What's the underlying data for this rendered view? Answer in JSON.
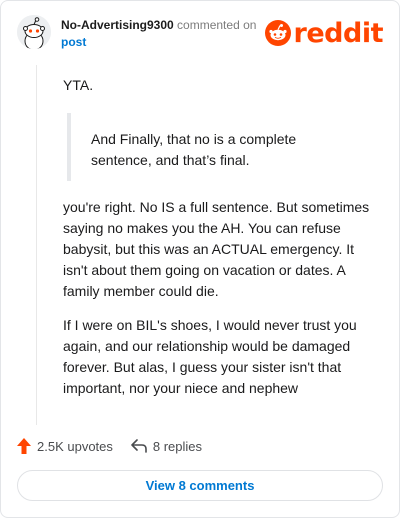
{
  "header": {
    "username": "No-Advertising9300",
    "commented_text": "commented on",
    "post_link": "post",
    "logo_text": "reddit"
  },
  "comment": {
    "paragraph_1": "YTA.",
    "quote": "And Finally, that no is a complete sentence, and that’s final.",
    "paragraph_2": "you're right. No IS a full sentence. But sometimes saying no makes you the AH. You can refuse babysit, but this was an ACTUAL emergency. It isn't about them going on vacation or dates. A family member could die.",
    "paragraph_3": "If I were on BIL's shoes, I would never trust you again, and our relationship would be damaged forever. But alas, I guess your sister isn't that important, nor your niece and nephew"
  },
  "actions": {
    "upvotes": "2.5K upvotes",
    "replies": "8 replies"
  },
  "view_button": "View 8 comments",
  "colors": {
    "brand": "#ff4500",
    "link": "#0079d3",
    "muted": "#7c7c7c"
  },
  "icons": [
    "snoo-avatar-icon",
    "reddit-logo-icon",
    "upvote-arrow-icon",
    "reply-arrow-icon"
  ]
}
